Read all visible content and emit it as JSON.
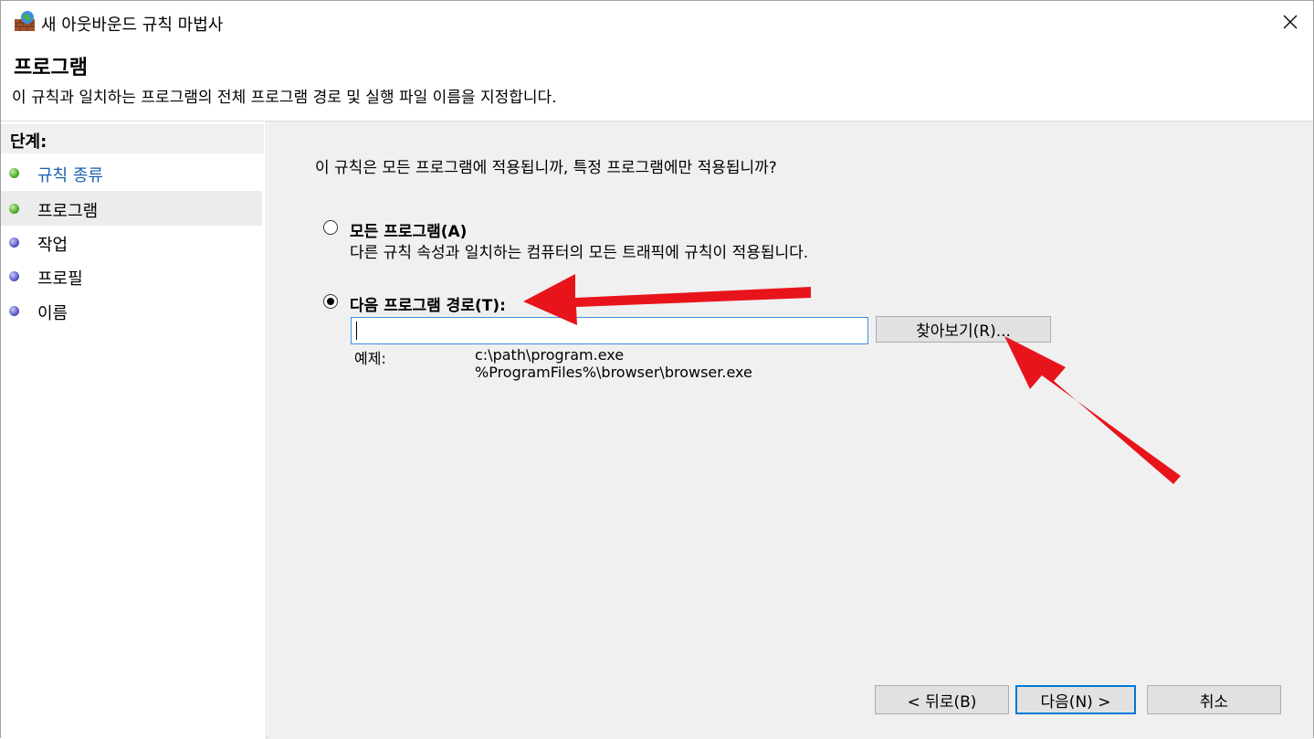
{
  "window": {
    "title": "새 아웃바운드 규칙 마법사"
  },
  "header": {
    "title": "프로그램",
    "description": "이 규칙과 일치하는 프로그램의 전체 프로그램 경로 및 실행 파일 이름을 지정합니다."
  },
  "steps": {
    "heading": "단계:",
    "items": [
      {
        "label": "규칙 종류",
        "status": "completed",
        "dot_color": "#3aa020"
      },
      {
        "label": "프로그램",
        "status": "current",
        "dot_color": "#3aa020"
      },
      {
        "label": "작업",
        "status": "pending",
        "dot_color": "#4a4ab8"
      },
      {
        "label": "프로필",
        "status": "pending",
        "dot_color": "#4a4ab8"
      },
      {
        "label": "이름",
        "status": "pending",
        "dot_color": "#4a4ab8"
      }
    ]
  },
  "main": {
    "question": "이 규칙은 모든 프로그램에 적용됩니까, 특정 프로그램에만 적용됩니까?",
    "option_all": {
      "label": "모든 프로그램(A)",
      "description": "다른 규칙 속성과 일치하는 컴퓨터의 모든 트래픽에 규칙이 적용됩니다.",
      "selected": false
    },
    "option_path": {
      "label": "다음 프로그램 경로(T):",
      "selected": true,
      "value": ""
    },
    "browse_label": "찾아보기(R)...",
    "example_label": "예제:",
    "example_1": "c:\\path\\program.exe",
    "example_2": "%ProgramFiles%\\browser\\browser.exe"
  },
  "footer": {
    "back_label": "< 뒤로(B)",
    "next_label": "다음(N) >",
    "cancel_label": "취소"
  },
  "annotations": {
    "arrow_color": "#e8141b"
  }
}
